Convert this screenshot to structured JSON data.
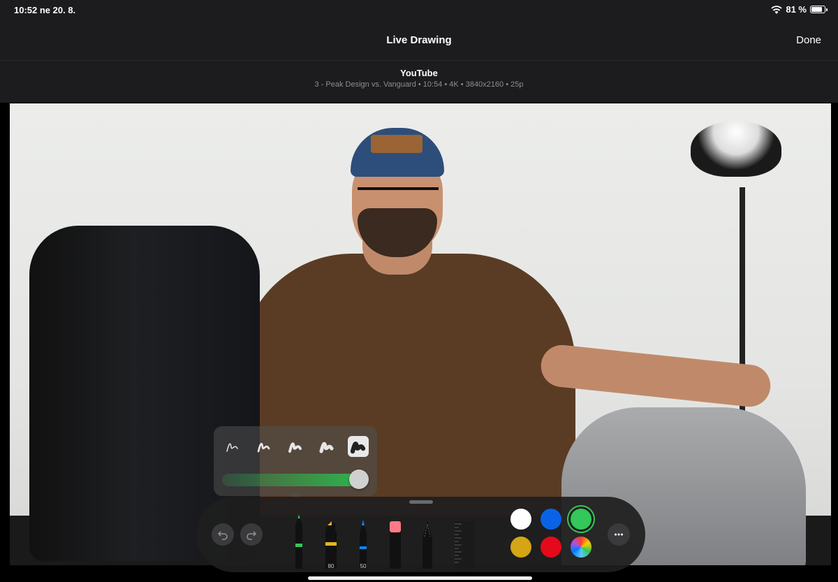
{
  "status_bar": {
    "time_date": "10:52  ne 20. 8.",
    "battery_text": "81 %",
    "battery_level": 0.81
  },
  "nav": {
    "title": "Live Drawing",
    "done_label": "Done"
  },
  "video_info": {
    "title": "YouTube",
    "subtitle": "3 - Peak Design vs. Vanguard • 10:54 • 4K • 3840x2160 • 25p"
  },
  "stroke_popover": {
    "options": [
      "size-1",
      "size-2",
      "size-3",
      "size-4",
      "size-5"
    ],
    "selected_index": 4,
    "opacity": 0.9,
    "color": "#34c759"
  },
  "palette": {
    "tools": [
      {
        "name": "pen-tool",
        "label": "",
        "color": "#34c759"
      },
      {
        "name": "marker-tool",
        "label": "80",
        "color": "#e6b422"
      },
      {
        "name": "pencil-tool",
        "label": "50",
        "color": "#0a84ff"
      },
      {
        "name": "eraser-tool",
        "label": "",
        "color": "#ff7a85"
      },
      {
        "name": "lasso-tool",
        "label": "",
        "color": "#666666"
      },
      {
        "name": "ruler-tool",
        "label": "",
        "color": "#555555"
      }
    ],
    "colors": [
      {
        "name": "white",
        "hex": "#ffffff"
      },
      {
        "name": "blue",
        "hex": "#0a63e6"
      },
      {
        "name": "green",
        "hex": "#34c759",
        "selected": true
      },
      {
        "name": "yellow",
        "hex": "#d4a514"
      },
      {
        "name": "red",
        "hex": "#e5091c"
      },
      {
        "name": "multicolor",
        "hex": "conic"
      }
    ]
  }
}
